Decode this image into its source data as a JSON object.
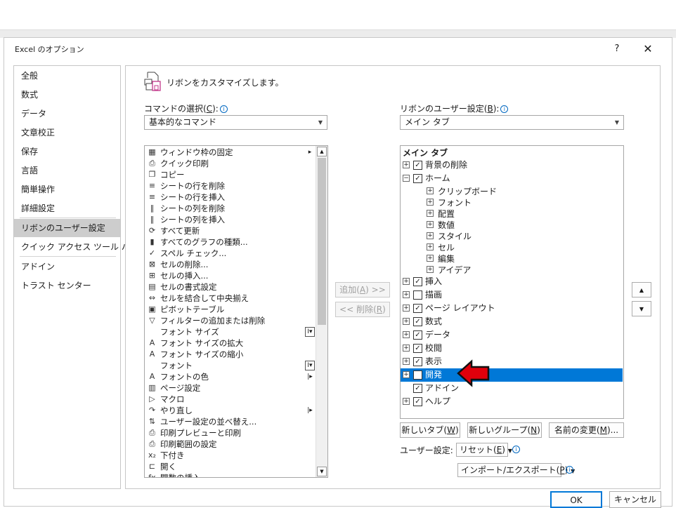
{
  "window": {
    "title": "Excel のオプション",
    "help": "?",
    "close": "✕"
  },
  "nav": {
    "items": [
      {
        "label": "全般"
      },
      {
        "label": "数式"
      },
      {
        "label": "データ"
      },
      {
        "label": "文章校正"
      },
      {
        "label": "保存"
      },
      {
        "label": "言語"
      },
      {
        "label": "簡単操作"
      },
      {
        "label": "詳細設定"
      },
      {
        "label": "リボンのユーザー設定"
      },
      {
        "label": "クイック アクセス ツール バー"
      },
      {
        "label": "アドイン"
      },
      {
        "label": "トラスト センター"
      }
    ],
    "selected_index": 8
  },
  "heading": "リボンをカスタマイズします。",
  "commands": {
    "label": "コマンドの選択(C):",
    "label_prefix": "コマンドの選択(",
    "label_key": "C",
    "label_suffix": "):",
    "combo_value": "基本的なコマンド",
    "list": [
      {
        "icon": "freeze-panes-icon",
        "glyph": "▦",
        "label": "ウィンドウ枠の固定",
        "trail": "▸"
      },
      {
        "icon": "quick-print-icon",
        "glyph": "⎙",
        "label": "クイック印刷"
      },
      {
        "icon": "copy-icon",
        "glyph": "❐",
        "label": "コピー"
      },
      {
        "icon": "delete-row-icon",
        "glyph": "≡",
        "label": "シートの行を削除"
      },
      {
        "icon": "insert-row-icon",
        "glyph": "≡",
        "label": "シートの行を挿入"
      },
      {
        "icon": "delete-column-icon",
        "glyph": "‖",
        "label": "シートの列を削除"
      },
      {
        "icon": "insert-column-icon",
        "glyph": "‖",
        "label": "シートの列を挿入"
      },
      {
        "icon": "refresh-all-icon",
        "glyph": "⟳",
        "label": "すべて更新"
      },
      {
        "icon": "chart-types-icon",
        "glyph": "▮",
        "label": "すべてのグラフの種類..."
      },
      {
        "icon": "spelling-icon",
        "glyph": "✓",
        "label": "スペル チェック..."
      },
      {
        "icon": "delete-cells-icon",
        "glyph": "⊠",
        "label": "セルの削除..."
      },
      {
        "icon": "insert-cells-icon",
        "glyph": "⊞",
        "label": "セルの挿入..."
      },
      {
        "icon": "format-cells-icon",
        "glyph": "▤",
        "label": "セルの書式設定"
      },
      {
        "icon": "merge-center-icon",
        "glyph": "⇔",
        "label": "セルを結合して中央揃え"
      },
      {
        "icon": "pivot-table-icon",
        "glyph": "▣",
        "label": "ピボットテーブル"
      },
      {
        "icon": "filter-icon",
        "glyph": "▽",
        "label": "フィルターの追加または削除"
      },
      {
        "icon": "",
        "glyph": "",
        "label": "フォント サイズ",
        "trail": "I▾",
        "trail_box": true
      },
      {
        "icon": "grow-font-icon",
        "glyph": "A",
        "label": "フォント サイズの拡大"
      },
      {
        "icon": "shrink-font-icon",
        "glyph": "A",
        "label": "フォント サイズの縮小"
      },
      {
        "icon": "",
        "glyph": "",
        "label": "フォント",
        "trail": "I▾",
        "trail_box": true
      },
      {
        "icon": "font-color-icon",
        "glyph": "A",
        "label": "フォントの色",
        "trail": "|▸"
      },
      {
        "icon": "page-setup-icon",
        "glyph": "▥",
        "label": "ページ設定"
      },
      {
        "icon": "macro-icon",
        "glyph": "▷",
        "label": "マクロ"
      },
      {
        "icon": "redo-icon",
        "glyph": "↷",
        "label": "やり直し",
        "trail": "|▸"
      },
      {
        "icon": "custom-sort-icon",
        "glyph": "⇅",
        "label": "ユーザー設定の並べ替え..."
      },
      {
        "icon": "print-preview-icon",
        "glyph": "⎙",
        "label": "印刷プレビューと印刷"
      },
      {
        "icon": "print-area-icon",
        "glyph": "⎙",
        "label": "印刷範囲の設定"
      },
      {
        "icon": "subscript-icon",
        "glyph": "x₂",
        "label": "下付き"
      },
      {
        "icon": "open-icon",
        "glyph": "⊏",
        "label": "開く"
      },
      {
        "icon": "insert-function-icon",
        "glyph": "fx",
        "label": "関数の挿入"
      }
    ]
  },
  "middle": {
    "add_prefix": "追加(",
    "add_key": "A",
    "add_suffix": ") >>",
    "remove_prefix": "<< 削除(",
    "remove_key": "R",
    "remove_suffix": ")"
  },
  "ribbon": {
    "label_prefix": "リボンのユーザー設定(",
    "label_key": "B",
    "label_suffix": "):",
    "combo_value": "メイン タブ",
    "tree_header": "メイン タブ",
    "tree": [
      {
        "label": "背景の削除",
        "level": 0,
        "expander": "+",
        "checked": true
      },
      {
        "label": "ホーム",
        "level": 0,
        "expander": "−",
        "checked": true
      },
      {
        "label": "クリップボード",
        "level": 1,
        "expander": "+"
      },
      {
        "label": "フォント",
        "level": 1,
        "expander": "+"
      },
      {
        "label": "配置",
        "level": 1,
        "expander": "+"
      },
      {
        "label": "数値",
        "level": 1,
        "expander": "+"
      },
      {
        "label": "スタイル",
        "level": 1,
        "expander": "+"
      },
      {
        "label": "セル",
        "level": 1,
        "expander": "+"
      },
      {
        "label": "編集",
        "level": 1,
        "expander": "+"
      },
      {
        "label": "アイデア",
        "level": 1,
        "expander": "+"
      },
      {
        "label": "挿入",
        "level": 0,
        "expander": "+",
        "checked": true
      },
      {
        "label": "描画",
        "level": 0,
        "expander": "+",
        "checked": false
      },
      {
        "label": "ページ レイアウト",
        "level": 0,
        "expander": "+",
        "checked": true
      },
      {
        "label": "数式",
        "level": 0,
        "expander": "+",
        "checked": true
      },
      {
        "label": "データ",
        "level": 0,
        "expander": "+",
        "checked": true
      },
      {
        "label": "校閲",
        "level": 0,
        "expander": "+",
        "checked": true
      },
      {
        "label": "表示",
        "level": 0,
        "expander": "+",
        "checked": true
      },
      {
        "label": "開発",
        "level": 0,
        "expander": "+",
        "checked": false,
        "selected": true
      },
      {
        "label": "アドイン",
        "level": 0,
        "expander": "",
        "checked": true
      },
      {
        "label": "ヘルプ",
        "level": 0,
        "expander": "+",
        "checked": true
      }
    ],
    "move_up": "▲",
    "move_down": "▼",
    "new_tab_prefix": "新しいタブ(",
    "new_tab_key": "W",
    "new_tab_suffix": ")",
    "new_group_prefix": "新しいグループ(",
    "new_group_key": "N",
    "new_group_suffix": ")",
    "rename_prefix": "名前の変更(",
    "rename_key": "M",
    "rename_suffix": ")...",
    "user_settings_label": "ユーザー設定:",
    "reset_prefix": "リセット(",
    "reset_key": "E",
    "reset_suffix": ")",
    "import_export_prefix": "インポート/エクスポート(",
    "import_export_key": "P",
    "import_export_suffix": ")"
  },
  "footer": {
    "ok": "OK",
    "cancel": "キャンセル"
  },
  "colors": {
    "selection": "#0078d7",
    "info_blue": "#0067c0",
    "arrow_red": "#e0000b"
  }
}
